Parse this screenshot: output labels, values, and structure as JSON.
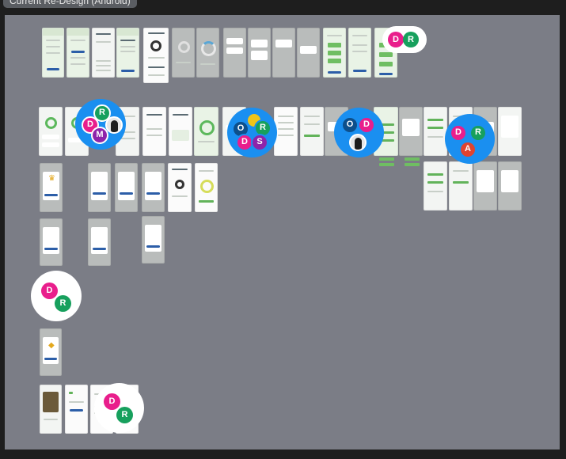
{
  "frame": {
    "title": "Current Re-Design (Android)"
  },
  "colors": {
    "canvas": "#7b7d86",
    "accent_green": "#62b35a",
    "button_blue": "#2c5ea8",
    "presence_blue": "#1a8ff0",
    "avatar_pink": "#e91e8c",
    "avatar_green": "#17a05d",
    "avatar_purple": "#8e24aa",
    "avatar_navy": "#0d4f8b",
    "avatar_red": "#e0432f",
    "avatar_yellow": "#f0c419"
  },
  "collaborators": {
    "cluster_top_right": [
      "D",
      "R"
    ],
    "cluster_row2_a": [
      "R",
      "D",
      "M"
    ],
    "cluster_row2_b": [
      "O",
      "R",
      "D",
      "S"
    ],
    "cluster_row2_c": [
      "O",
      "D"
    ],
    "cluster_row2_d": [
      "D",
      "R",
      "A"
    ],
    "cluster_left": [
      "D",
      "R"
    ],
    "cluster_bottom": [
      "D",
      "R"
    ]
  }
}
